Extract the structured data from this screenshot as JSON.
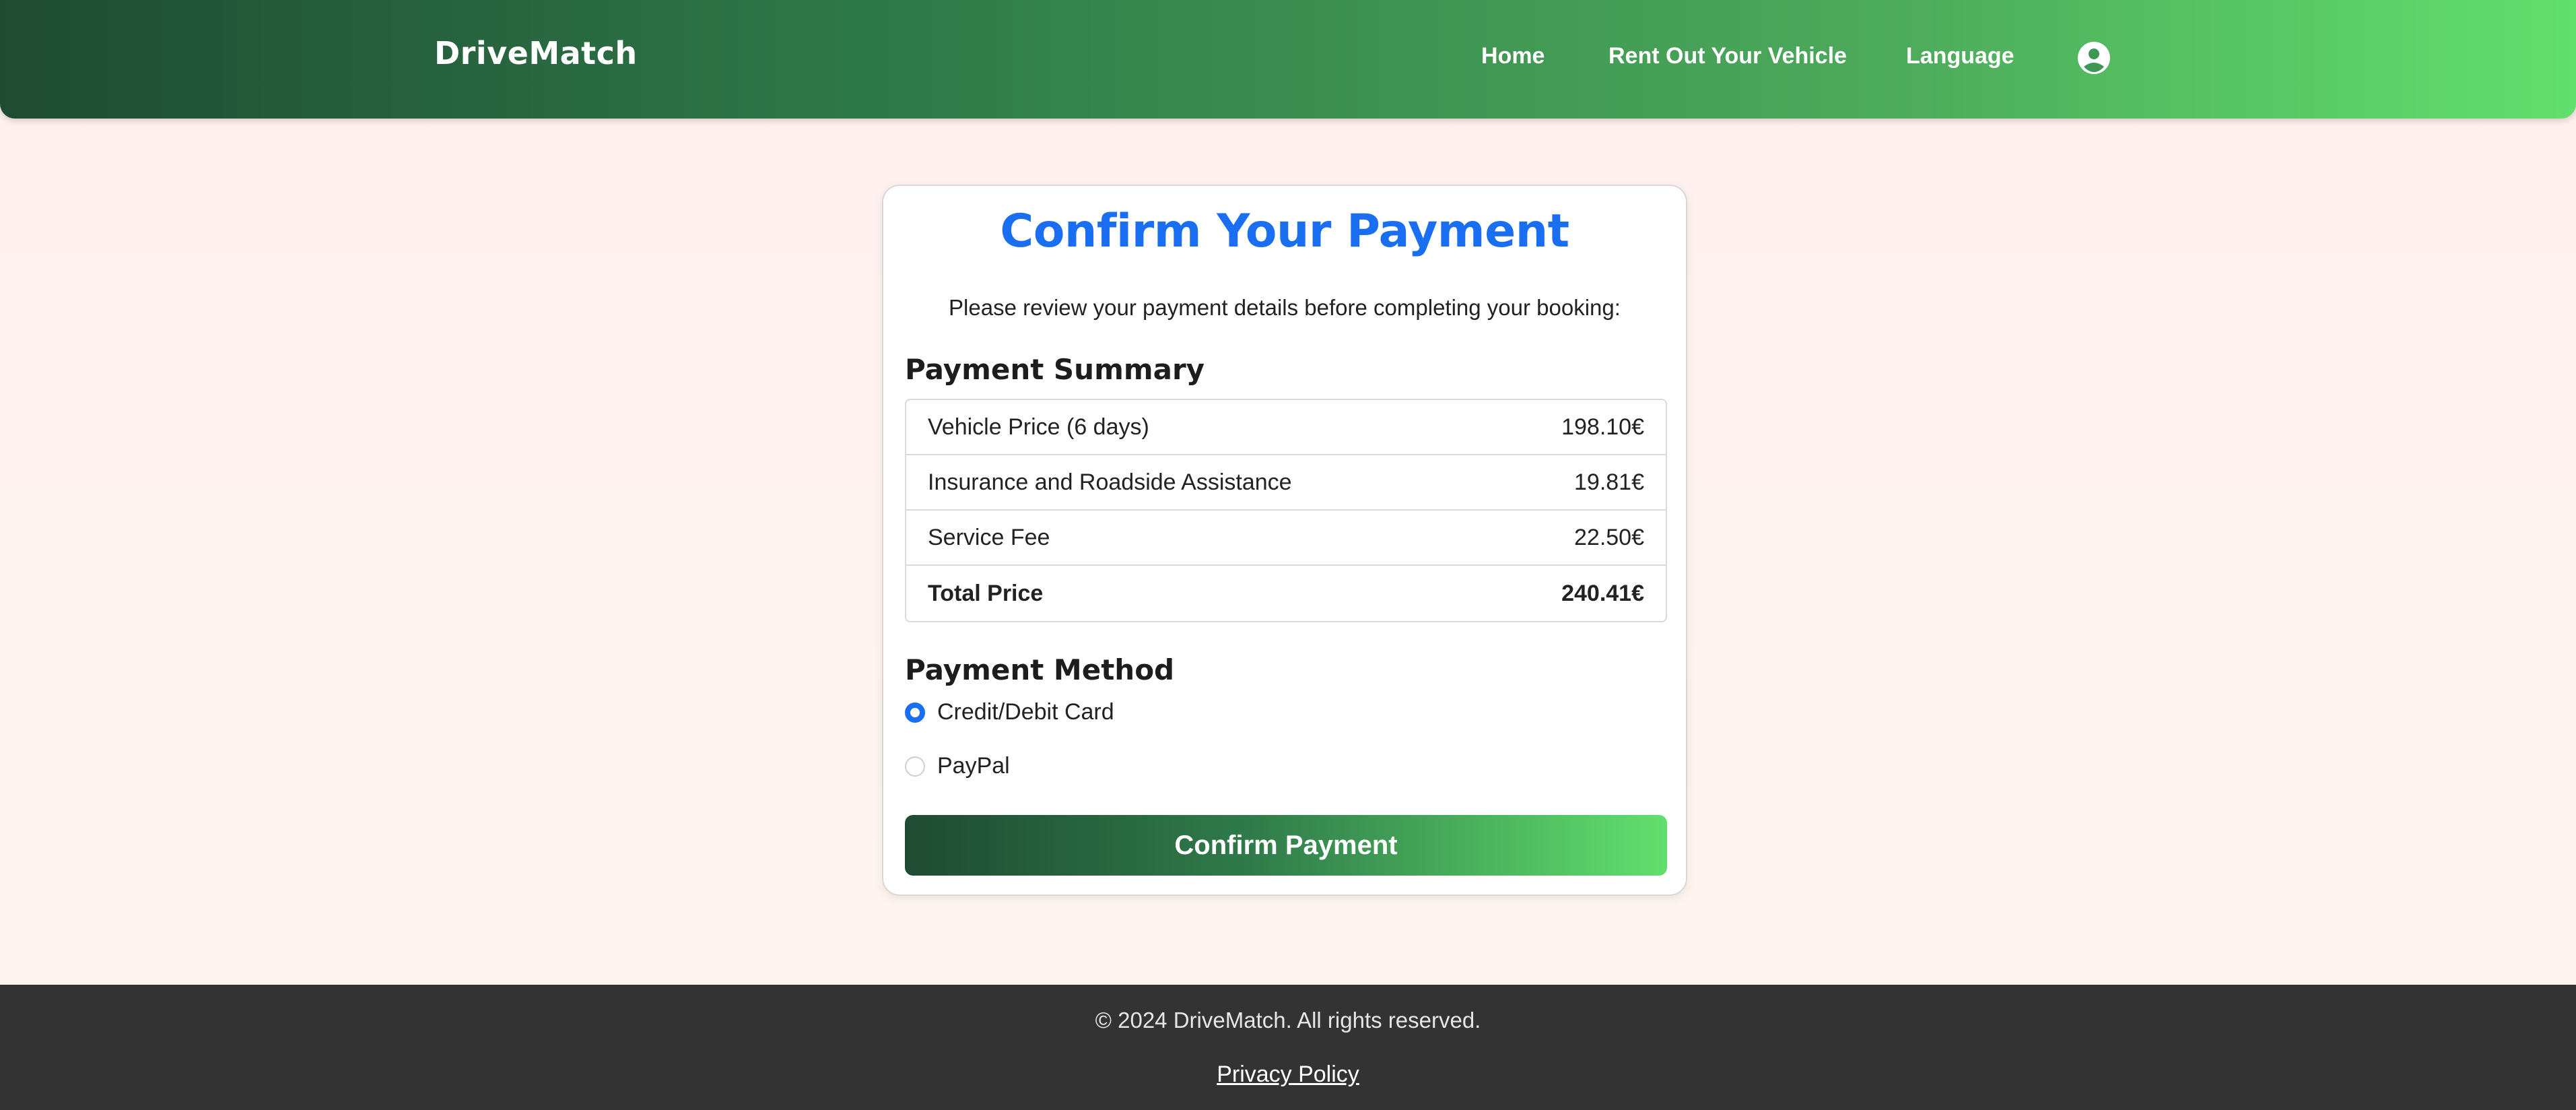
{
  "nav": {
    "brand": "DriveMatch",
    "links": [
      "Home",
      "Rent Out Your Vehicle",
      "Language"
    ],
    "profile_icon": "user-circle-icon"
  },
  "payment": {
    "title": "Confirm Your Payment",
    "intro": "Please review your payment details before completing your booking:",
    "summary_heading": "Payment Summary",
    "rows": [
      {
        "label": "Vehicle Price (6 days)",
        "value": "198.10€"
      },
      {
        "label": "Insurance and Roadside Assistance",
        "value": "19.81€"
      },
      {
        "label": "Service Fee",
        "value": "22.50€"
      },
      {
        "label": "Total Price",
        "value": "240.41€"
      }
    ],
    "method_heading": "Payment Method",
    "methods": [
      {
        "label": "Credit/Debit Card",
        "selected": true
      },
      {
        "label": "PayPal",
        "selected": false
      }
    ],
    "confirm_label": "Confirm Payment"
  },
  "footer": {
    "copyright": "© 2024 DriveMatch. All rights reserved.",
    "privacy": "Privacy Policy"
  },
  "colors": {
    "accent": "#1a6ef2",
    "gradient_start": "#1f4b33",
    "gradient_end": "#62df6e",
    "footer_bg": "#333333"
  }
}
